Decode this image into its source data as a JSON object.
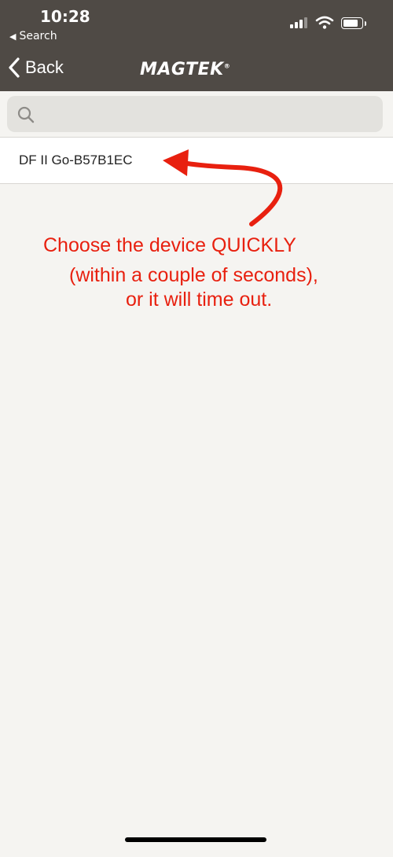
{
  "status_bar": {
    "time": "10:28",
    "back_app": "Search"
  },
  "nav": {
    "back_label": "Back",
    "brand": "MAGTEK",
    "brand_mark": "®"
  },
  "search": {
    "placeholder": "",
    "value": ""
  },
  "devices": [
    {
      "name": "DF II Go-B57B1EC"
    }
  ],
  "annotation": {
    "line1": "Choose the device QUICKLY",
    "line2": "(within a couple of seconds),",
    "line3": "or it will time out.",
    "color": "#e8200f"
  },
  "colors": {
    "header_bg": "#4f4a45",
    "page_bg": "#f5f4f1",
    "search_bg": "#e3e2de"
  }
}
